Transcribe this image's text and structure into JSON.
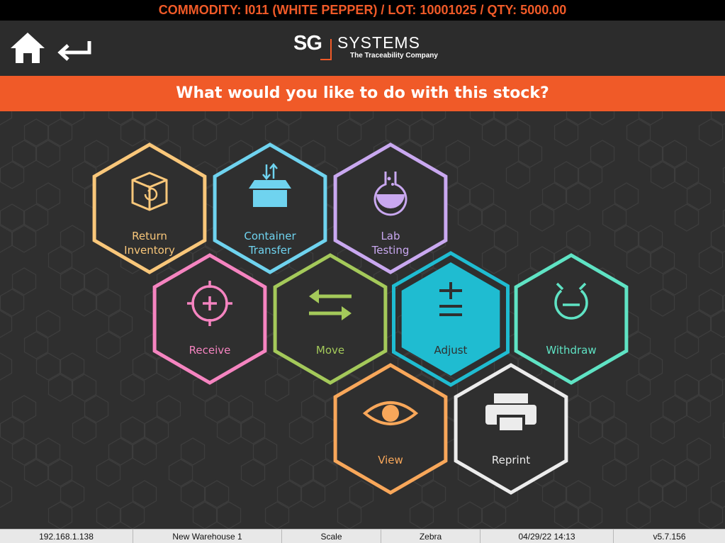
{
  "banner": {
    "text": "COMMODITY: I011 (WHITE PEPPER) / LOT: 10001025 / QTY: 5000.00"
  },
  "header": {
    "logo": {
      "mark": "SG",
      "word": "SYSTEMS",
      "tagline": "The Traceability Company"
    }
  },
  "prompt": "What would you like to do with this stock?",
  "actions": [
    {
      "id": "return-inventory",
      "line1": "Return",
      "line2": "Inventory",
      "color": "#f9c77a",
      "icon": "box-return-icon"
    },
    {
      "id": "container-transfer",
      "line1": "Container",
      "line2": "Transfer",
      "color": "#6fd3ef",
      "icon": "container-transfer-icon"
    },
    {
      "id": "lab-testing",
      "line1": "Lab",
      "line2": "Testing",
      "color": "#c9a8f0",
      "icon": "flask-icon"
    },
    {
      "id": "receive",
      "line1": "Receive",
      "line2": "",
      "color": "#f584c0",
      "icon": "crosshair-plus-icon"
    },
    {
      "id": "move",
      "line1": "Move",
      "line2": "",
      "color": "#a4c95a",
      "icon": "swap-arrows-icon"
    },
    {
      "id": "adjust",
      "line1": "Adjust",
      "line2": "",
      "color": "#1fbcd1",
      "icon": "plus-minus-icon",
      "selected": true
    },
    {
      "id": "withdraw",
      "line1": "Withdraw",
      "line2": "",
      "color": "#5fe3c4",
      "icon": "withdraw-icon"
    },
    {
      "id": "view",
      "line1": "View",
      "line2": "",
      "color": "#f8a75a",
      "icon": "eye-icon"
    },
    {
      "id": "reprint",
      "line1": "Reprint",
      "line2": "",
      "color": "#ececec",
      "icon": "printer-icon"
    }
  ],
  "status": [
    {
      "label": "192.168.1.138"
    },
    {
      "label": "New Warehouse 1"
    },
    {
      "label": "Scale"
    },
    {
      "label": "Zebra"
    },
    {
      "label": "04/29/22 14:13"
    },
    {
      "label": "v5.7.156"
    }
  ]
}
